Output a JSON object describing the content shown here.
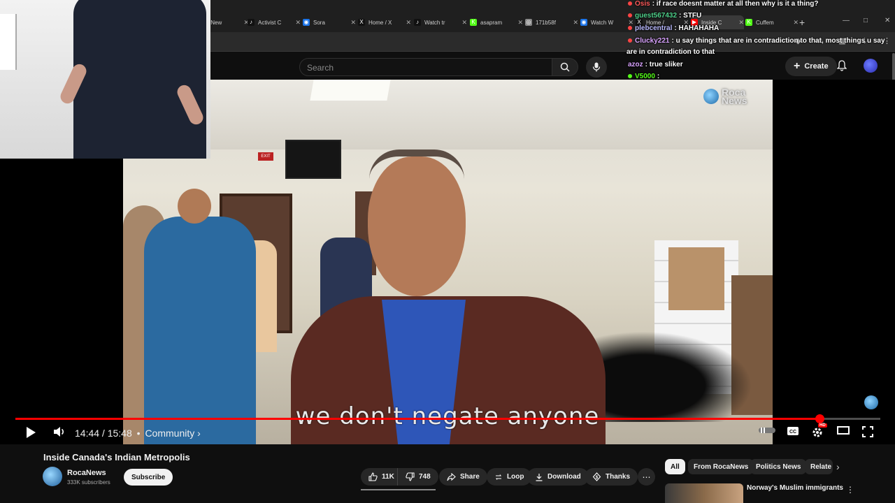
{
  "browser": {
    "tabs": [
      {
        "label": "y New",
        "icon": "generic-icon"
      },
      {
        "label": "Activist C",
        "icon": "tiktok-icon"
      },
      {
        "label": "Sora",
        "icon": "sora-icon"
      },
      {
        "label": "Home / X",
        "icon": "x-icon"
      },
      {
        "label": "Watch tr",
        "icon": "tiktok-icon"
      },
      {
        "label": "asapram",
        "icon": "kick-icon"
      },
      {
        "label": "171b58f",
        "icon": "globe-icon"
      },
      {
        "label": "Watch W",
        "icon": "sora-icon"
      },
      {
        "label": "Home /",
        "icon": "x-icon"
      },
      {
        "label": "Inside C",
        "icon": "youtube-icon",
        "active": true
      },
      {
        "label": "Cuffem",
        "icon": "kick-icon"
      }
    ],
    "new_tab": "+"
  },
  "youtube": {
    "search_placeholder": "Search",
    "create_label": "Create"
  },
  "video": {
    "caption": "we don't negate anyone",
    "watermark": "Roca\nNews",
    "current_time": "14:44",
    "duration": "15:48",
    "time_display": "14:44 / 15:48",
    "chapter": "Community",
    "progress": 0.93,
    "hd_badge": "HD"
  },
  "chat": [
    {
      "user": "Osis",
      "text": ": if race doesnt matter at all then why is it a thing?",
      "dot": "#ff4444"
    },
    {
      "user": "guest567432",
      "text": ": STFU",
      "dot": "#ff4444",
      "user_color": "#4fd18b"
    },
    {
      "user": "plebcentral",
      "text": ": HAHAHAHA",
      "dot": "#ff4444",
      "user_color": "#b9b9ff"
    },
    {
      "user": "Clucky221",
      "text": ": u say things that are in contradiction to that, most things u say",
      "dot": "#ff4444",
      "user_color": "#d9a3ff"
    },
    {
      "user": "",
      "text": "are in contradiction to that",
      "dot": ""
    },
    {
      "user": "azoz",
      "text": ": true sliker",
      "dot": "",
      "user_color": "#d9a3ff"
    },
    {
      "user": "V5000",
      "text": ":",
      "dot": "#53fc18",
      "user_color": "#53fc18"
    }
  ],
  "details": {
    "title": "Inside Canada's Indian Metropolis",
    "channel": "RocaNews",
    "subscribers": "333K subscribers",
    "subscribe_label": "Subscribe",
    "likes": "11K",
    "dislikes": "748",
    "share": "Share",
    "loop": "Loop",
    "download": "Download",
    "thanks": "Thanks",
    "more": "⋯"
  },
  "sidebar": {
    "chips": [
      "All",
      "From RocaNews",
      "Politics News",
      "Relate"
    ],
    "related_title": "Norway's Muslim immigrants"
  }
}
